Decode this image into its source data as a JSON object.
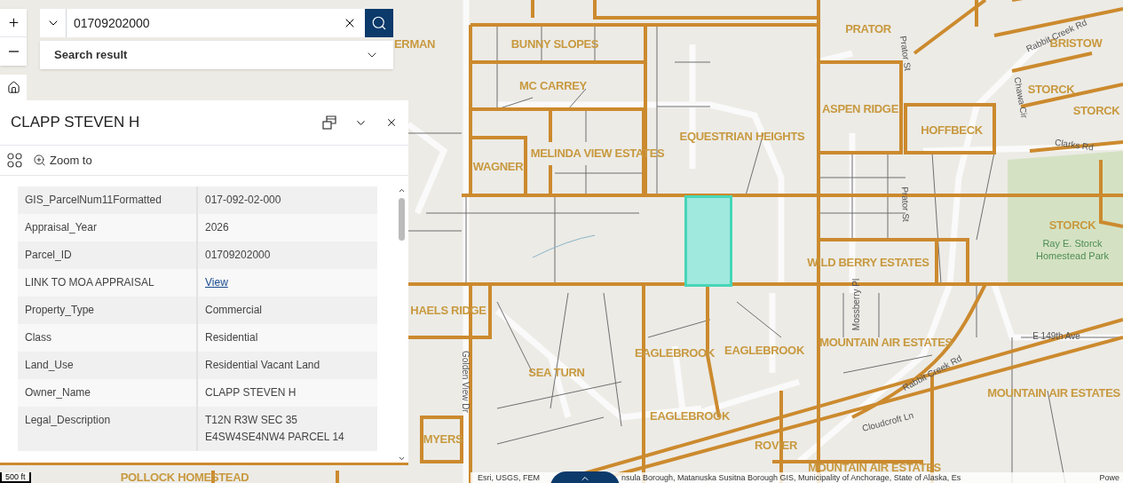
{
  "search": {
    "value": "01709202000",
    "result_label": "Search result"
  },
  "popup": {
    "title": "CLAPP STEVEN H",
    "zoom_label": "Zoom to",
    "rows": [
      {
        "label": "GIS_ParcelNum11Formatted",
        "kind": "text",
        "lines": [
          "017-092-02-000"
        ]
      },
      {
        "label": "Appraisal_Year",
        "kind": "text",
        "lines": [
          "2026"
        ]
      },
      {
        "label": "Parcel_ID",
        "kind": "text",
        "lines": [
          "01709202000"
        ]
      },
      {
        "label": "LINK TO MOA APPRAISAL",
        "kind": "link",
        "lines": [
          "View"
        ]
      },
      {
        "label": "Property_Type",
        "kind": "text",
        "lines": [
          "Commercial"
        ]
      },
      {
        "label": "Class",
        "kind": "text",
        "lines": [
          "Residential"
        ]
      },
      {
        "label": "Land_Use",
        "kind": "text",
        "lines": [
          "Residential Vacant Land"
        ]
      },
      {
        "label": "Owner_Name",
        "kind": "text",
        "lines": [
          "CLAPP STEVEN H"
        ]
      },
      {
        "label": "Legal_Description",
        "kind": "text",
        "lines": [
          "T12N R3W SEC 35",
          "E4SW4SE4NW4 PARCEL 14"
        ]
      }
    ]
  },
  "map": {
    "labels": [
      {
        "text": "ERMAN",
        "kind": "subdivision"
      },
      {
        "text": "BUNNY SLOPES",
        "kind": "subdivision"
      },
      {
        "text": "MC CARREY",
        "kind": "subdivision"
      },
      {
        "text": "MELINDA VIEW ESTATES",
        "kind": "subdivision"
      },
      {
        "text": "WAGNER",
        "kind": "subdivision"
      },
      {
        "text": "EQUESTRIAN HEIGHTS",
        "kind": "subdivision"
      },
      {
        "text": "PRATOR",
        "kind": "subdivision"
      },
      {
        "text": "ASPEN RIDGE",
        "kind": "subdivision"
      },
      {
        "text": "HOFFBECK",
        "kind": "subdivision"
      },
      {
        "text": "BRISTOW",
        "kind": "subdivision"
      },
      {
        "text": "STORCK",
        "kind": "subdivision"
      },
      {
        "text": "STORCK",
        "kind": "subdivision"
      },
      {
        "text": "STORCK",
        "kind": "subdivision"
      },
      {
        "text": "Ray E. Storck\nHomestead Park",
        "kind": "park"
      },
      {
        "text": "WILD BERRY ESTATES",
        "kind": "subdivision"
      },
      {
        "text": "HAELS RIDGE",
        "kind": "subdivision"
      },
      {
        "text": "SEA TURN",
        "kind": "subdivision"
      },
      {
        "text": "EAGLEBROOK",
        "kind": "subdivision"
      },
      {
        "text": "EAGLEBROOK",
        "kind": "subdivision"
      },
      {
        "text": "EAGLEBROOK",
        "kind": "subdivision"
      },
      {
        "text": "MOUNTAIN AIR ESTATES",
        "kind": "subdivision"
      },
      {
        "text": "MOUNTAIN AIR ESTATES",
        "kind": "subdivision"
      },
      {
        "text": "MOUNTAIN AIR ESTATES",
        "kind": "subdivision"
      },
      {
        "text": "ROVIER",
        "kind": "subdivision"
      },
      {
        "text": "MYERS",
        "kind": "subdivision"
      },
      {
        "text": "POLLOCK HOMESTEAD",
        "kind": "subdivision"
      },
      {
        "text": "Rabbit Creek Rd",
        "kind": "street"
      },
      {
        "text": "Clarks Rd",
        "kind": "street"
      },
      {
        "text": "Chawa Cir",
        "kind": "street"
      },
      {
        "text": "Prator St",
        "kind": "street"
      },
      {
        "text": "Prator St",
        "kind": "street"
      },
      {
        "text": "E 149th Ave",
        "kind": "street"
      },
      {
        "text": "Rabbit Creek Rd",
        "kind": "street"
      },
      {
        "text": "Golden View Dr",
        "kind": "street"
      },
      {
        "text": "Cloudcroft Ln",
        "kind": "street"
      },
      {
        "text": "Mossberry Pl",
        "kind": "street"
      }
    ],
    "scale": "500 ft",
    "attribution": [
      "Esri, USGS, FEM",
      "nsula Borough, Matanuska Susitna Borough GIS, Municipality of Anchorage, State of Alaska, Es",
      "Powe"
    ]
  }
}
